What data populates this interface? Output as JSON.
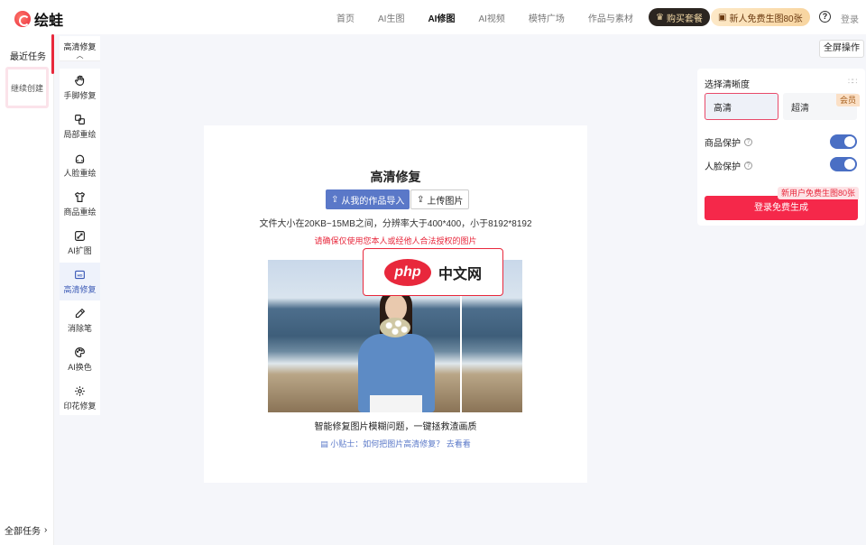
{
  "header": {
    "logo_text": "绘蛙",
    "nav": [
      {
        "label": "首页",
        "active": false
      },
      {
        "label": "AI生图",
        "active": false
      },
      {
        "label": "AI修图",
        "active": true
      },
      {
        "label": "AI视频",
        "active": false
      },
      {
        "label": "模特广场",
        "active": false
      },
      {
        "label": "作品与素材",
        "active": false
      }
    ],
    "buy_label": "购买套餐",
    "free_label": "新人免费生图80张",
    "login_label": "登录"
  },
  "left": {
    "recent_title": "最近任务",
    "continue_label": "继续创建",
    "all_tasks_label": "全部任务"
  },
  "tools": {
    "header_label": "高清修复",
    "items": [
      {
        "label": "手脚修复",
        "icon": "hand-icon"
      },
      {
        "label": "局部重绘",
        "icon": "region-icon"
      },
      {
        "label": "人脸重绘",
        "icon": "face-icon"
      },
      {
        "label": "商品重绘",
        "icon": "shirt-icon"
      },
      {
        "label": "AI扩图",
        "icon": "expand-icon"
      },
      {
        "label": "高清修复",
        "icon": "hd-icon",
        "active": true
      },
      {
        "label": "消除笔",
        "icon": "pen-icon"
      },
      {
        "label": "AI换色",
        "icon": "palette-icon"
      },
      {
        "label": "印花修复",
        "icon": "print-icon"
      }
    ]
  },
  "fullscreen_label": "全屏操作",
  "settings": {
    "title": "选择清晰度",
    "hd_label": "高清",
    "uhd_label": "超清",
    "member_tag": "会员",
    "product_protect_label": "商品保护",
    "face_protect_label": "人脸保护",
    "promo_tag": "新用户免费生图80张",
    "generate_label": "登录免费生成"
  },
  "main": {
    "title": "高清修复",
    "import_label": "从我的作品导入",
    "upload_label": "上传图片",
    "spec_text": "文件大小在20KB~15MB之间，分辨率大于400*400，小于8192*8192",
    "warn_text": "请确保仅使用您本人或经他人合法授权的图片",
    "caption": "智能修复图片模糊问题，一键拯救渣画质",
    "tip": "小贴士：如何把图片高清修复？ 去看看"
  },
  "watermark": {
    "logo": "php",
    "text": "中文网"
  }
}
